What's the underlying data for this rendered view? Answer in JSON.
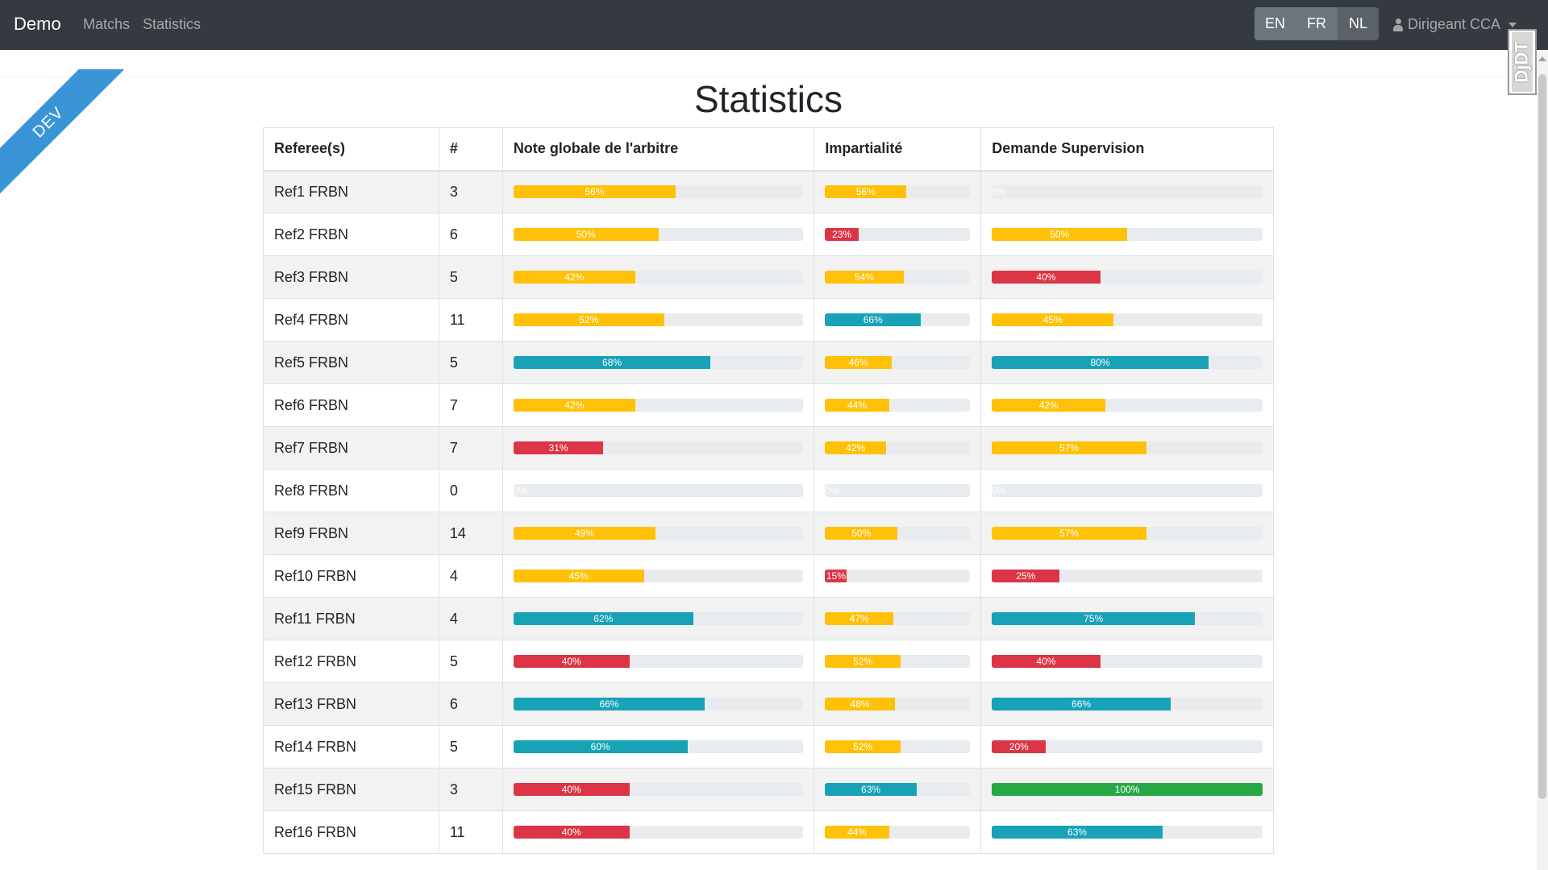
{
  "navbar": {
    "brand": "Demo",
    "links": [
      "Matchs",
      "Statistics"
    ],
    "languages": [
      "EN",
      "FR",
      "NL"
    ],
    "user": "Dirigeant CCA"
  },
  "ribbon": "DEV",
  "debug_toolbar": "DjDT",
  "page": {
    "title": "Statistics"
  },
  "table": {
    "headers": [
      "Referee(s)",
      "#",
      "Note globale de l'arbitre",
      "Impartialité",
      "Demande Supervision"
    ],
    "rows": [
      {
        "name": "Ref1 FRBN",
        "count": "3",
        "note": 56,
        "imp": 56,
        "dem": 0
      },
      {
        "name": "Ref2 FRBN",
        "count": "6",
        "note": 50,
        "imp": 23,
        "dem": 50
      },
      {
        "name": "Ref3 FRBN",
        "count": "5",
        "note": 42,
        "imp": 54,
        "dem": 40
      },
      {
        "name": "Ref4 FRBN",
        "count": "11",
        "note": 52,
        "imp": 66,
        "dem": 45
      },
      {
        "name": "Ref5 FRBN",
        "count": "5",
        "note": 68,
        "imp": 46,
        "dem": 80
      },
      {
        "name": "Ref6 FRBN",
        "count": "7",
        "note": 42,
        "imp": 44,
        "dem": 42
      },
      {
        "name": "Ref7 FRBN",
        "count": "7",
        "note": 31,
        "imp": 42,
        "dem": 57
      },
      {
        "name": "Ref8 FRBN",
        "count": "0",
        "note": 0,
        "imp": 0,
        "dem": 0
      },
      {
        "name": "Ref9 FRBN",
        "count": "14",
        "note": 49,
        "imp": 50,
        "dem": 57
      },
      {
        "name": "Ref10 FRBN",
        "count": "4",
        "note": 45,
        "imp": 15,
        "dem": 25
      },
      {
        "name": "Ref11 FRBN",
        "count": "4",
        "note": 62,
        "imp": 47,
        "dem": 75
      },
      {
        "name": "Ref12 FRBN",
        "count": "5",
        "note": 40,
        "imp": 52,
        "dem": 40
      },
      {
        "name": "Ref13 FRBN",
        "count": "6",
        "note": 66,
        "imp": 48,
        "dem": 66
      },
      {
        "name": "Ref14 FRBN",
        "count": "5",
        "note": 60,
        "imp": 52,
        "dem": 20
      },
      {
        "name": "Ref15 FRBN",
        "count": "3",
        "note": 40,
        "imp": 63,
        "dem": 100
      },
      {
        "name": "Ref16 FRBN",
        "count": "11",
        "note": 40,
        "imp": 44,
        "dem": 63
      }
    ]
  },
  "colors": {
    "warning": "#ffc107",
    "danger": "#dc3545",
    "info": "#17a2b8",
    "success": "#28a745",
    "navbar": "#343a40",
    "ribbon": "#3a94d6"
  }
}
